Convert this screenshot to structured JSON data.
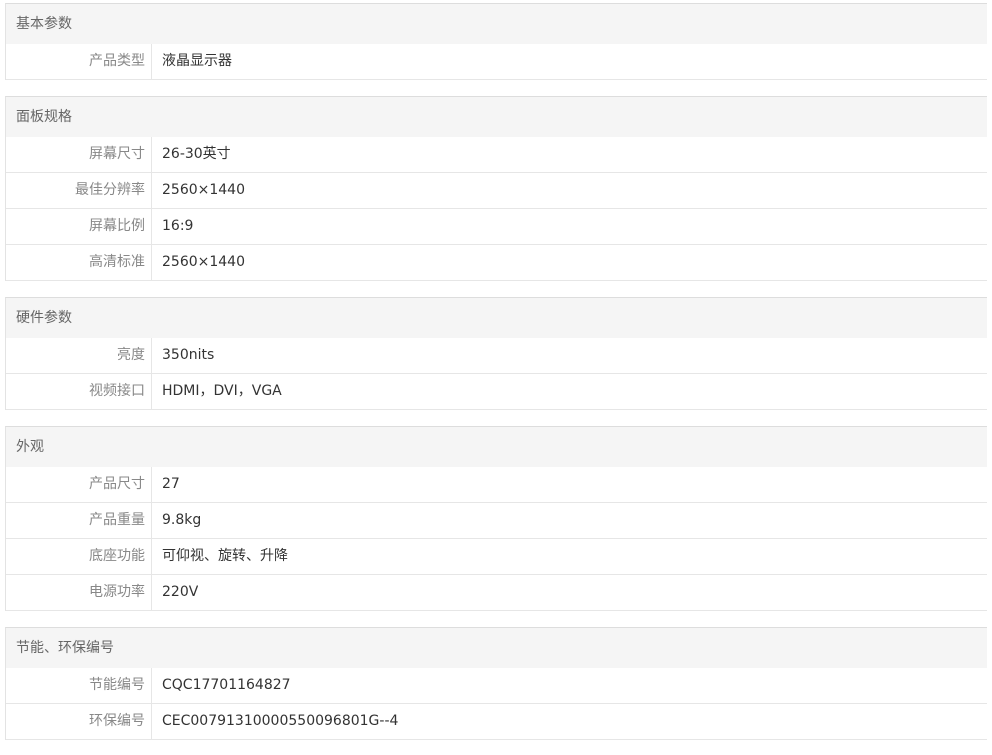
{
  "groups": [
    {
      "title": "基本参数",
      "rows": [
        {
          "label": "产品类型",
          "value": "液晶显示器"
        }
      ]
    },
    {
      "title": "面板规格",
      "rows": [
        {
          "label": "屏幕尺寸",
          "value": "26-30英寸"
        },
        {
          "label": "最佳分辨率",
          "value": "2560×1440"
        },
        {
          "label": "屏幕比例",
          "value": "16:9"
        },
        {
          "label": "高清标准",
          "value": "2560×1440"
        }
      ]
    },
    {
      "title": "硬件参数",
      "rows": [
        {
          "label": "亮度",
          "value": "350nits"
        },
        {
          "label": "视频接口",
          "value": "HDMI，DVI，VGA"
        }
      ]
    },
    {
      "title": "外观",
      "rows": [
        {
          "label": "产品尺寸",
          "value": "27"
        },
        {
          "label": "产品重量",
          "value": "9.8kg"
        },
        {
          "label": "底座功能",
          "value": "可仰视、旋转、升降"
        },
        {
          "label": "电源功率",
          "value": "220V"
        }
      ]
    },
    {
      "title": "节能、环保编号",
      "rows": [
        {
          "label": "节能编号",
          "value": "CQC17701164827"
        },
        {
          "label": "环保编号",
          "value": "CEC00791310000550096801G--4"
        }
      ]
    }
  ]
}
